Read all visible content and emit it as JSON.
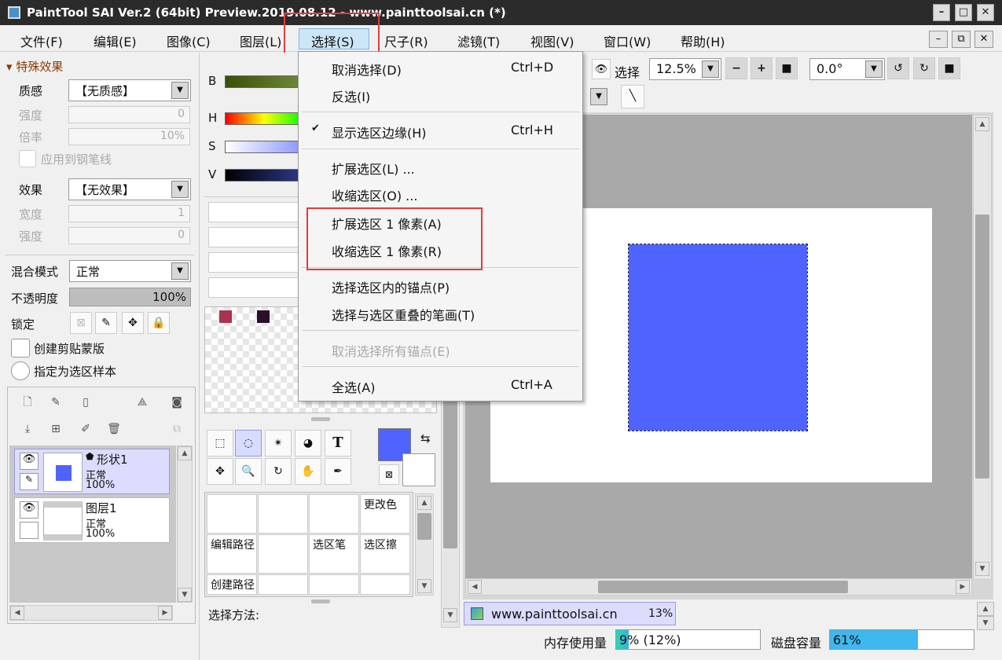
{
  "window": {
    "title": "PaintTool SAI Ver.2 (64bit) Preview.2019.08.12 - www.painttoolsai.cn (*)",
    "app_icon": "sai-app-icon"
  },
  "menubar": {
    "items": [
      "文件(F)",
      "编辑(E)",
      "图像(C)",
      "图层(L)",
      "选择(S)",
      "尺子(R)",
      "滤镜(T)",
      "视图(V)",
      "窗口(W)",
      "帮助(H)"
    ],
    "active": "选择(S)"
  },
  "select_menu": {
    "items": [
      {
        "label": "取消选择(D)",
        "shortcut": "Ctrl+D",
        "enabled": true
      },
      {
        "label": "反选(I)",
        "shortcut": "",
        "enabled": true
      },
      {
        "label": "显示选区边缘(H)",
        "shortcut": "Ctrl+H",
        "enabled": true,
        "checked": true
      },
      {
        "label": "扩展选区(L) ...",
        "shortcut": "",
        "enabled": true
      },
      {
        "label": "收缩选区(O) ...",
        "shortcut": "",
        "enabled": true
      },
      {
        "label": "扩展选区 1 像素(A)",
        "shortcut": "",
        "enabled": true
      },
      {
        "label": "收缩选区 1 像素(R)",
        "shortcut": "",
        "enabled": true
      },
      {
        "label": "选择选区内的锚点(P)",
        "shortcut": "",
        "enabled": true
      },
      {
        "label": "选择与选区重叠的笔画(T)",
        "shortcut": "",
        "enabled": true
      },
      {
        "label": "取消选择所有锚点(E)",
        "shortcut": "",
        "enabled": false
      },
      {
        "label": "全选(A)",
        "shortcut": "Ctrl+A",
        "enabled": true
      }
    ]
  },
  "left_panel": {
    "section_title": "特殊效果",
    "texture_label": "质感",
    "texture_value": "【无质感】",
    "strength_label": "强度",
    "strength_value": "0",
    "scale_label": "倍率",
    "scale_value": "10%",
    "apply_pen_label": "应用到钢笔线",
    "effect_label": "效果",
    "effect_value": "【无效果】",
    "width_label": "宽度",
    "width_value": "1",
    "strength2_label": "强度",
    "strength2_value": "0",
    "blend_label": "混合模式",
    "blend_value": "正常",
    "opacity_label": "不透明度",
    "opacity_value": "100%",
    "opacity_fraction": 1.0,
    "lock_label": "锁定",
    "clip_label": "创建剪贴蒙版",
    "sample_label": "指定为选区样本"
  },
  "layers": [
    {
      "name": "形状1",
      "mode": "正常",
      "opacity": "100%",
      "selected": true
    },
    {
      "name": "图层1",
      "mode": "正常",
      "opacity": "100%",
      "selected": false
    }
  ],
  "color_panel": {
    "b_label": "B",
    "h_label": "H",
    "s_label": "S",
    "v_label": "V",
    "primary_color": "#4f63ff",
    "secondary_color": "#ffffff",
    "swatches": [
      "#a8344f",
      "#2a0f2a"
    ]
  },
  "tool_panel": {
    "cells": [
      "",
      "",
      "",
      "更改色",
      "编辑路径",
      "",
      "选区笔",
      "选区擦",
      "创建路径",
      "",
      "",
      ""
    ],
    "method_label": "选择方法:"
  },
  "view_toolbar": {
    "select_label": "选择",
    "zoom": "12.5%",
    "rotation": "0.0°"
  },
  "canvas": {
    "shape_color": "#4f63ff"
  },
  "navigator": {
    "tab_label": "www.painttoolsai.cn",
    "tab_percent": "13%"
  },
  "status": {
    "memory_label": "内存使用量",
    "memory_value": "9% (12%)",
    "memory_fraction": 0.09,
    "disk_label": "磁盘容量",
    "disk_value": "61%",
    "disk_fraction": 0.61
  }
}
